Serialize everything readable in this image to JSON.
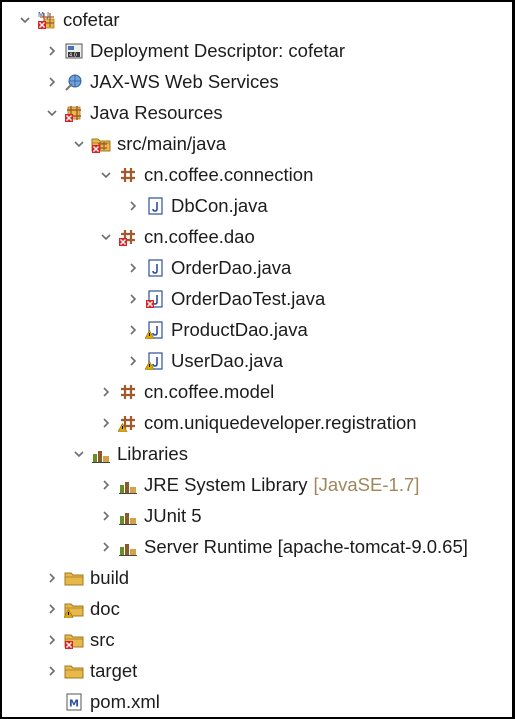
{
  "tree": [
    {
      "label": "cofetar",
      "depth": 0,
      "twisty": "down",
      "icon": "maven-project-icon",
      "name": "tree-node-cofetar"
    },
    {
      "label": "Deployment Descriptor: cofetar",
      "depth": 1,
      "twisty": "right",
      "icon": "deployment-descriptor-icon",
      "name": "tree-node-deployment-descriptor"
    },
    {
      "label": "JAX-WS Web Services",
      "depth": 1,
      "twisty": "right",
      "icon": "web-services-icon",
      "name": "tree-node-jax-ws"
    },
    {
      "label": "Java Resources",
      "depth": 1,
      "twisty": "down",
      "icon": "java-resources-icon",
      "name": "tree-node-java-resources"
    },
    {
      "label": "src/main/java",
      "depth": 2,
      "twisty": "down",
      "icon": "source-folder-error-icon",
      "name": "tree-node-src-main-java"
    },
    {
      "label": "cn.coffee.connection",
      "depth": 3,
      "twisty": "down",
      "icon": "package-icon",
      "name": "tree-node-pkg-connection"
    },
    {
      "label": "DbCon.java",
      "depth": 4,
      "twisty": "right",
      "icon": "java-file-icon",
      "name": "tree-node-dbcon"
    },
    {
      "label": "cn.coffee.dao",
      "depth": 3,
      "twisty": "down",
      "icon": "package-error-icon",
      "name": "tree-node-pkg-dao"
    },
    {
      "label": "OrderDao.java",
      "depth": 4,
      "twisty": "right",
      "icon": "java-file-icon",
      "name": "tree-node-orderdao"
    },
    {
      "label": "OrderDaoTest.java",
      "depth": 4,
      "twisty": "right",
      "icon": "java-file-error-icon",
      "name": "tree-node-orderdaotest"
    },
    {
      "label": "ProductDao.java",
      "depth": 4,
      "twisty": "right",
      "icon": "java-file-warning-icon",
      "name": "tree-node-productdao"
    },
    {
      "label": "UserDao.java",
      "depth": 4,
      "twisty": "right",
      "icon": "java-file-warning-icon",
      "name": "tree-node-userdao"
    },
    {
      "label": "cn.coffee.model",
      "depth": 3,
      "twisty": "right",
      "icon": "package-icon",
      "name": "tree-node-pkg-model"
    },
    {
      "label": "com.uniquedeveloper.registration",
      "depth": 3,
      "twisty": "right",
      "icon": "package-warning-icon",
      "name": "tree-node-pkg-registration"
    },
    {
      "label": "Libraries",
      "depth": 2,
      "twisty": "down",
      "icon": "library-icon",
      "name": "tree-node-libraries"
    },
    {
      "label": "JRE System Library",
      "deco": "[JavaSE-1.7]",
      "depth": 3,
      "twisty": "right",
      "icon": "library-icon",
      "name": "tree-node-jre"
    },
    {
      "label": "JUnit 5",
      "depth": 3,
      "twisty": "right",
      "icon": "library-icon",
      "name": "tree-node-junit"
    },
    {
      "label": "Server Runtime [apache-tomcat-9.0.65]",
      "depth": 3,
      "twisty": "right",
      "icon": "library-icon",
      "name": "tree-node-server-runtime"
    },
    {
      "label": "build",
      "depth": 1,
      "twisty": "right",
      "icon": "folder-icon",
      "name": "tree-node-build"
    },
    {
      "label": "doc",
      "depth": 1,
      "twisty": "right",
      "icon": "folder-warning-icon",
      "name": "tree-node-doc"
    },
    {
      "label": "src",
      "depth": 1,
      "twisty": "right",
      "icon": "folder-error-icon",
      "name": "tree-node-src"
    },
    {
      "label": "target",
      "depth": 1,
      "twisty": "right",
      "icon": "folder-icon",
      "name": "tree-node-target"
    },
    {
      "label": "pom.xml",
      "depth": 1,
      "twisty": "none",
      "icon": "maven-pom-icon",
      "name": "tree-node-pom"
    }
  ],
  "colors": {
    "text": "#1c1c1c",
    "decoration": "#a0865a",
    "twisty": "#6e6e6e",
    "folder": "#e8b84a",
    "package": "#a05a2c",
    "error": "#d8232a",
    "warning": "#e0a800",
    "java_file": "#2d4f9e"
  }
}
